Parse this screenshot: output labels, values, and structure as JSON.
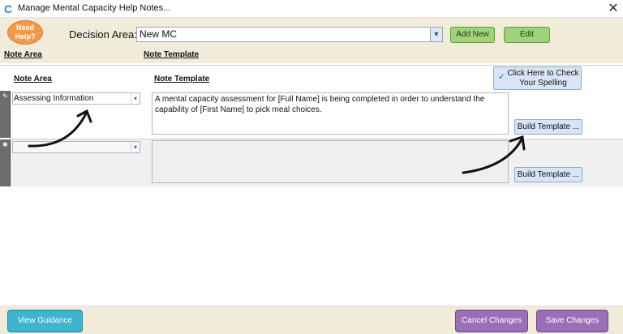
{
  "window": {
    "title": "Manage Mental Capacity Help Notes...",
    "app_icon": "c-logo-icon",
    "close_glyph": "✕"
  },
  "header": {
    "help_label_line1": "Need",
    "help_label_line2": "Help?",
    "decision_area_label": "Decision Area:",
    "decision_area_value": "New MC",
    "add_new_label": "Add New",
    "edit_label": "Edit",
    "col_note_area": "Note Area",
    "col_note_template": "Note Template"
  },
  "grid": {
    "col_note_area": "Note Area",
    "col_note_template": "Note Template",
    "spell_check_label": "Click Here to Check Your Spelling",
    "rows": [
      {
        "note_area": "Assessing Information",
        "note_template": "A mental capacity assessment for [Full Name] is being completed in order to understand the capability of [First Name] to pick meal choices.",
        "build_label": "Build Template ..."
      },
      {
        "note_area": "",
        "note_template": "",
        "build_label": "Build Template ..."
      }
    ]
  },
  "footer": {
    "view_guidance_label": "View Guidance",
    "cancel_label": "Cancel Changes",
    "save_label": "Save Changes"
  },
  "colors": {
    "header_bg": "#f1ecd9",
    "help_orange": "#f29a4a",
    "green_button": "#9fd27a",
    "teal_button": "#3fb4cf",
    "purple_button": "#9b6fb8",
    "light_blue_button": "#d7e5f7"
  }
}
